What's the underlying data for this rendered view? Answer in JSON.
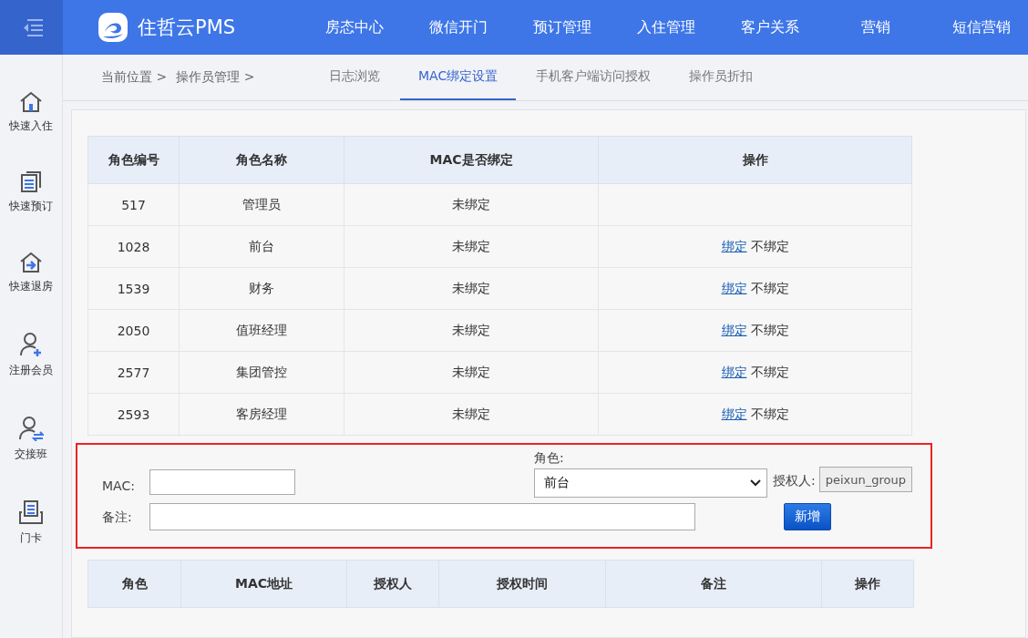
{
  "brand": {
    "name": "住哲云PMS"
  },
  "top_nav": [
    {
      "label": "房态中心"
    },
    {
      "label": "微信开门"
    },
    {
      "label": "预订管理"
    },
    {
      "label": "入住管理"
    },
    {
      "label": "客户关系"
    },
    {
      "label": "营销"
    },
    {
      "label": "短信营销"
    }
  ],
  "sidebar": {
    "items": [
      {
        "label": "快速入住",
        "kind": "house"
      },
      {
        "label": "快速预订",
        "kind": "doc"
      },
      {
        "label": "快速退房",
        "kind": "exit"
      },
      {
        "label": "注册会员",
        "kind": "useradd"
      },
      {
        "label": "交接班",
        "kind": "userswap"
      },
      {
        "label": "门卡",
        "kind": "card"
      }
    ]
  },
  "breadcrumb": [
    "当前位置 >",
    "操作员管理 >"
  ],
  "tabs": [
    {
      "label": "日志浏览",
      "selected": false
    },
    {
      "label": "MAC绑定设置",
      "selected": true
    },
    {
      "label": "手机客户端访问授权",
      "selected": false
    },
    {
      "label": "操作员折扣",
      "selected": false
    }
  ],
  "roles_table": {
    "columns": [
      "角色编号",
      "角色名称",
      "MAC是否绑定",
      "操作"
    ],
    "rows": [
      {
        "id": "517",
        "name": "管理员",
        "bound": "未绑定",
        "actions": []
      },
      {
        "id": "1028",
        "name": "前台",
        "bound": "未绑定",
        "actions": [
          {
            "label": "绑定",
            "kind": "link"
          },
          {
            "label": "不绑定",
            "kind": "text"
          }
        ]
      },
      {
        "id": "1539",
        "name": "财务",
        "bound": "未绑定",
        "actions": [
          {
            "label": "绑定",
            "kind": "link"
          },
          {
            "label": "不绑定",
            "kind": "text"
          }
        ]
      },
      {
        "id": "2050",
        "name": "值班经理",
        "bound": "未绑定",
        "actions": [
          {
            "label": "绑定",
            "kind": "link"
          },
          {
            "label": "不绑定",
            "kind": "text"
          }
        ]
      },
      {
        "id": "2577",
        "name": "集团管控",
        "bound": "未绑定",
        "actions": [
          {
            "label": "绑定",
            "kind": "link"
          },
          {
            "label": "不绑定",
            "kind": "text"
          }
        ]
      },
      {
        "id": "2593",
        "name": "客房经理",
        "bound": "未绑定",
        "actions": [
          {
            "label": "绑定",
            "kind": "link"
          },
          {
            "label": "不绑定",
            "kind": "text"
          }
        ]
      }
    ]
  },
  "form": {
    "mac_label": "MAC:",
    "role_label": "角色:",
    "role_value": "前台",
    "authorizer_label": "授权人:",
    "authorizer_value": "peixun_group",
    "note_label": "备注:",
    "add_button": "新增"
  },
  "bindings_table": {
    "columns": [
      "角色",
      "MAC地址",
      "授权人",
      "授权时间",
      "备注",
      "操作"
    ]
  }
}
